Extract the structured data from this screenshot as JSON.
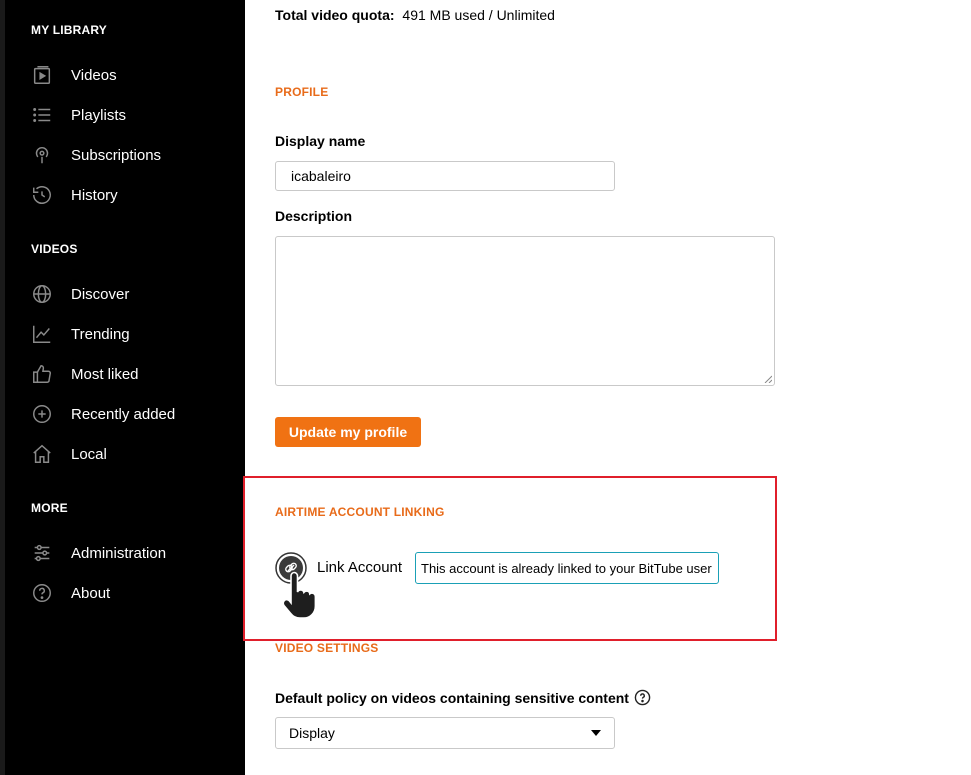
{
  "sidebar": {
    "sections": [
      {
        "title": "MY LIBRARY",
        "items": [
          {
            "label": "Videos",
            "icon": "video-icon"
          },
          {
            "label": "Playlists",
            "icon": "list-icon"
          },
          {
            "label": "Subscriptions",
            "icon": "podcast-icon"
          },
          {
            "label": "History",
            "icon": "history-icon"
          }
        ]
      },
      {
        "title": "VIDEOS",
        "items": [
          {
            "label": "Discover",
            "icon": "globe-icon"
          },
          {
            "label": "Trending",
            "icon": "trending-icon"
          },
          {
            "label": "Most liked",
            "icon": "thumbs-up-icon"
          },
          {
            "label": "Recently added",
            "icon": "plus-circle-icon"
          },
          {
            "label": "Local",
            "icon": "home-icon"
          }
        ]
      },
      {
        "title": "MORE",
        "items": [
          {
            "label": "Administration",
            "icon": "sliders-icon"
          },
          {
            "label": "About",
            "icon": "help-icon"
          }
        ]
      }
    ]
  },
  "main": {
    "quota_label": "Total video quota:",
    "quota_value": "491 MB used / Unlimited",
    "profile": {
      "section_title": "PROFILE",
      "display_name_label": "Display name",
      "display_name_value": "icabaleiro",
      "description_label": "Description",
      "description_value": "",
      "update_button": "Update my profile"
    },
    "airtime": {
      "section_title": "AIRTIME ACCOUNT LINKING",
      "link_label": "Link Account",
      "tooltip": "This account is already linked to your BitTube user"
    },
    "video_settings": {
      "section_title": "VIDEO SETTINGS",
      "sensitive_label": "Default policy on videos containing sensitive content",
      "sensitive_value": "Display"
    }
  },
  "colors": {
    "accent": "#f07213",
    "section_title": "#e86b1a",
    "highlight_border": "#e01f2b",
    "tooltip_border": "#1aa0b6",
    "sidebar_bg": "#000000"
  }
}
